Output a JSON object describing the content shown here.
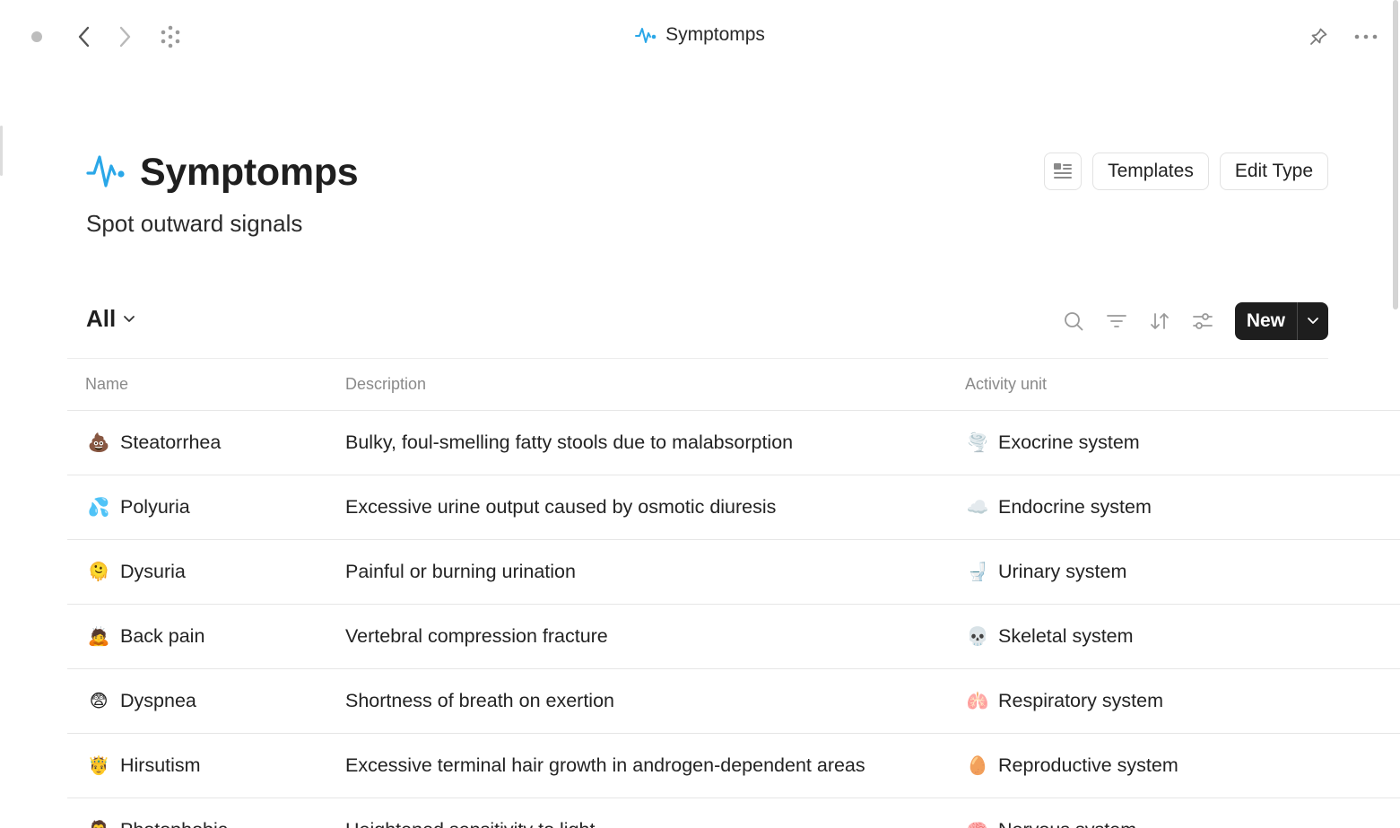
{
  "topbar": {
    "title": "Symptomps",
    "icons": {
      "window_dot": "status-dot",
      "back": "chevron-left-icon",
      "forward": "chevron-right-icon",
      "graph": "dots-grid-icon",
      "pin": "pin-icon",
      "more": "more-horizontal-icon"
    }
  },
  "header": {
    "title": "Symptomps",
    "subtitle": "Spot outward signals",
    "accent_color": "#2aa7e8",
    "actions": {
      "layout_icon": "layout-icon",
      "templates_label": "Templates",
      "edit_type_label": "Edit Type"
    }
  },
  "toolbar": {
    "view_label": "All",
    "new_label": "New",
    "icons": [
      "search-icon",
      "filter-icon",
      "sort-icon",
      "settings-sliders-icon"
    ]
  },
  "table": {
    "columns": [
      "Name",
      "Description",
      "Activity unit"
    ],
    "rows": [
      {
        "emoji": "💩",
        "name": "Steatorrhea",
        "description": "Bulky, foul-smelling fatty stools due to malabsorption",
        "unit_emoji": "🌪️",
        "unit": "Exocrine system"
      },
      {
        "emoji": "💦",
        "name": "Polyuria",
        "description": "Excessive urine output caused by osmotic diuresis",
        "unit_emoji": "☁️",
        "unit": "Endocrine system"
      },
      {
        "emoji": "🫠",
        "name": "Dysuria",
        "description": "Painful or burning urination",
        "unit_emoji": "🚽",
        "unit": "Urinary system"
      },
      {
        "emoji": "🙇",
        "name": "Back pain",
        "description": "Vertebral compression fracture",
        "unit_emoji": "💀",
        "unit": "Skeletal system"
      },
      {
        "emoji": "😨",
        "name": "Dyspnea",
        "description": "Shortness of breath on exertion",
        "unit_emoji": "🫁",
        "unit": "Respiratory system"
      },
      {
        "emoji": "🤴",
        "name": "Hirsutism",
        "description": "Excessive terminal hair growth in androgen-dependent areas",
        "unit_emoji": "🥚",
        "unit": "Reproductive system"
      },
      {
        "emoji": "🧛",
        "name": "Photophobia",
        "description": "Heightened sensitivity to light",
        "unit_emoji": "🧠",
        "unit": "Nervous system"
      }
    ]
  }
}
